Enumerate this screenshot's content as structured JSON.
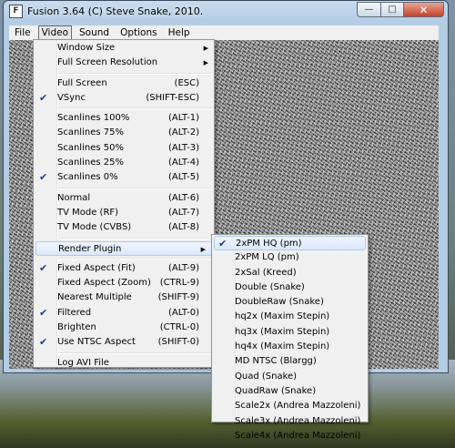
{
  "window": {
    "title": "Fusion 3.64 (C) Steve Snake, 2010."
  },
  "menubar": {
    "items": [
      "File",
      "Video",
      "Sound",
      "Options",
      "Help"
    ]
  },
  "video_menu": {
    "window_size": "Window Size",
    "full_screen_resolution": "Full Screen Resolution",
    "full_screen": {
      "label": "Full Screen",
      "shortcut": "(ESC)"
    },
    "vsync": {
      "label": "VSync",
      "shortcut": "(SHIFT-ESC)",
      "checked": true
    },
    "scanlines": [
      {
        "label": "Scanlines 100%",
        "shortcut": "(ALT-1)"
      },
      {
        "label": "Scanlines 75%",
        "shortcut": "(ALT-2)"
      },
      {
        "label": "Scanlines 50%",
        "shortcut": "(ALT-3)"
      },
      {
        "label": "Scanlines 25%",
        "shortcut": "(ALT-4)"
      },
      {
        "label": "Scanlines 0%",
        "shortcut": "(ALT-5)",
        "checked": true
      }
    ],
    "modes": [
      {
        "label": "Normal",
        "shortcut": "(ALT-6)"
      },
      {
        "label": "TV Mode (RF)",
        "shortcut": "(ALT-7)"
      },
      {
        "label": "TV Mode (CVBS)",
        "shortcut": "(ALT-8)"
      }
    ],
    "render_plugin": "Render Plugin",
    "options": [
      {
        "label": "Fixed Aspect (Fit)",
        "shortcut": "(ALT-9)",
        "checked": true
      },
      {
        "label": "Fixed Aspect (Zoom)",
        "shortcut": "(CTRL-9)"
      },
      {
        "label": "Nearest Multiple",
        "shortcut": "(SHIFT-9)"
      },
      {
        "label": "Filtered",
        "shortcut": "(ALT-0)",
        "checked": true
      },
      {
        "label": "Brighten",
        "shortcut": "(CTRL-0)"
      },
      {
        "label": "Use NTSC Aspect",
        "shortcut": "(SHIFT-0)",
        "checked": true
      }
    ],
    "log_avi": "Log AVI File"
  },
  "render_plugin_menu": {
    "items": [
      {
        "label": "2xPM HQ (pm)",
        "checked": true
      },
      {
        "label": "2xPM LQ (pm)"
      },
      {
        "label": "2xSal (Kreed)"
      },
      {
        "label": "Double (Snake)"
      },
      {
        "label": "DoubleRaw (Snake)"
      },
      {
        "label": "hq2x (Maxim Stepin)"
      },
      {
        "label": "hq3x (Maxim Stepin)"
      },
      {
        "label": "hq4x (Maxim Stepin)"
      },
      {
        "label": "MD NTSC (Blargg)"
      },
      {
        "label": "Quad (Snake)"
      },
      {
        "label": "QuadRaw (Snake)"
      },
      {
        "label": "Scale2x (Andrea Mazzoleni)"
      },
      {
        "label": "Scale3x (Andrea Mazzoleni)"
      },
      {
        "label": "Scale4x (Andrea Mazzoleni)"
      }
    ]
  },
  "icons": {
    "check": "check-icon",
    "submenu": "submenu-arrow-icon"
  }
}
